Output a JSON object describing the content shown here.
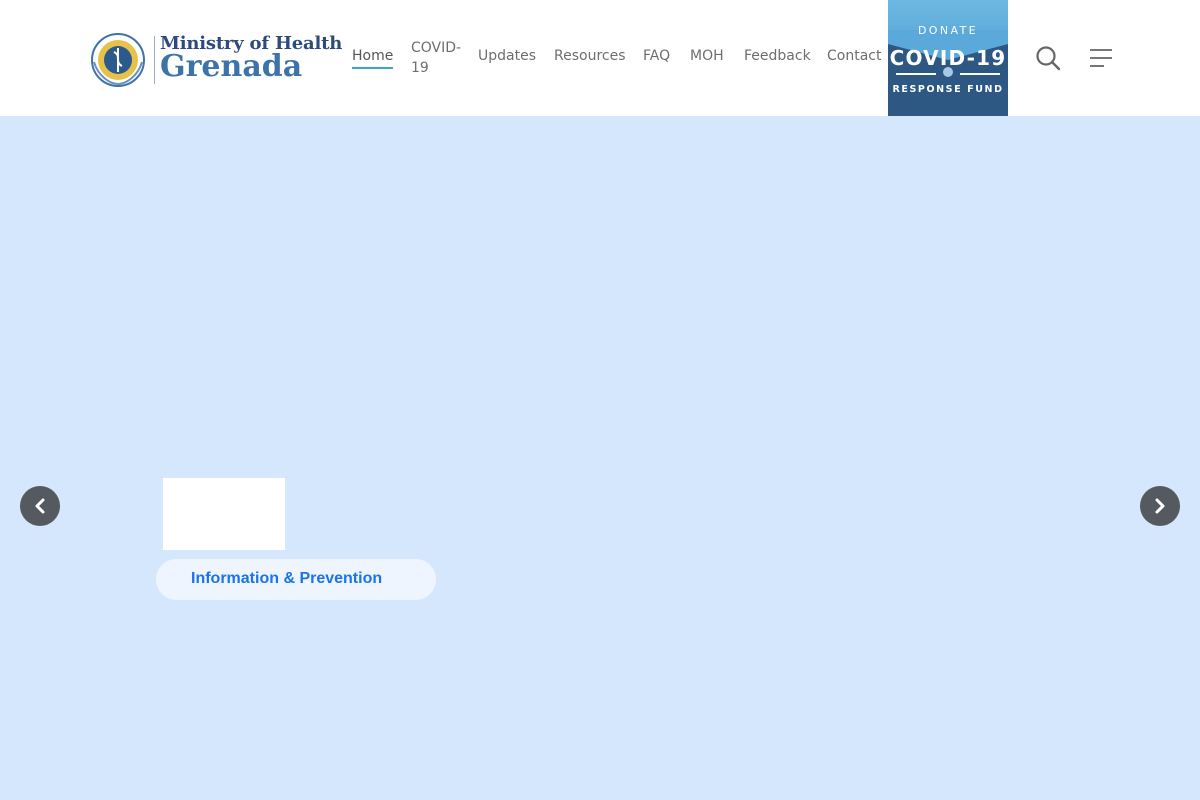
{
  "logo": {
    "line1": "Ministry of Health",
    "line2": "Grenada"
  },
  "nav": {
    "items": [
      {
        "label": "Home",
        "active": true
      },
      {
        "label": "COVID-19",
        "line1": "COVID-",
        "line2": "19"
      },
      {
        "label": "Updates"
      },
      {
        "label": "Resources"
      },
      {
        "label": "FAQ"
      },
      {
        "label": "MOH"
      },
      {
        "label": "Feedback"
      },
      {
        "label": "Contact"
      }
    ]
  },
  "donate": {
    "top": "DONATE",
    "main": "COVID-19",
    "bottom": "RESPONSE FUND"
  },
  "hero": {
    "pill_label": "Information & Prevention"
  },
  "icons": {
    "search": "search-icon",
    "menu": "menu-icon",
    "prev": "chevron-left-icon",
    "next": "chevron-right-icon",
    "emblem": "ministry-emblem-icon"
  },
  "colors": {
    "hero_background": "#d5e7fd",
    "accent_underline": "#3fa6c9",
    "pill_text": "#1a73e8",
    "donate_dark": "#2d5883",
    "donate_light": "#5aa9da"
  }
}
